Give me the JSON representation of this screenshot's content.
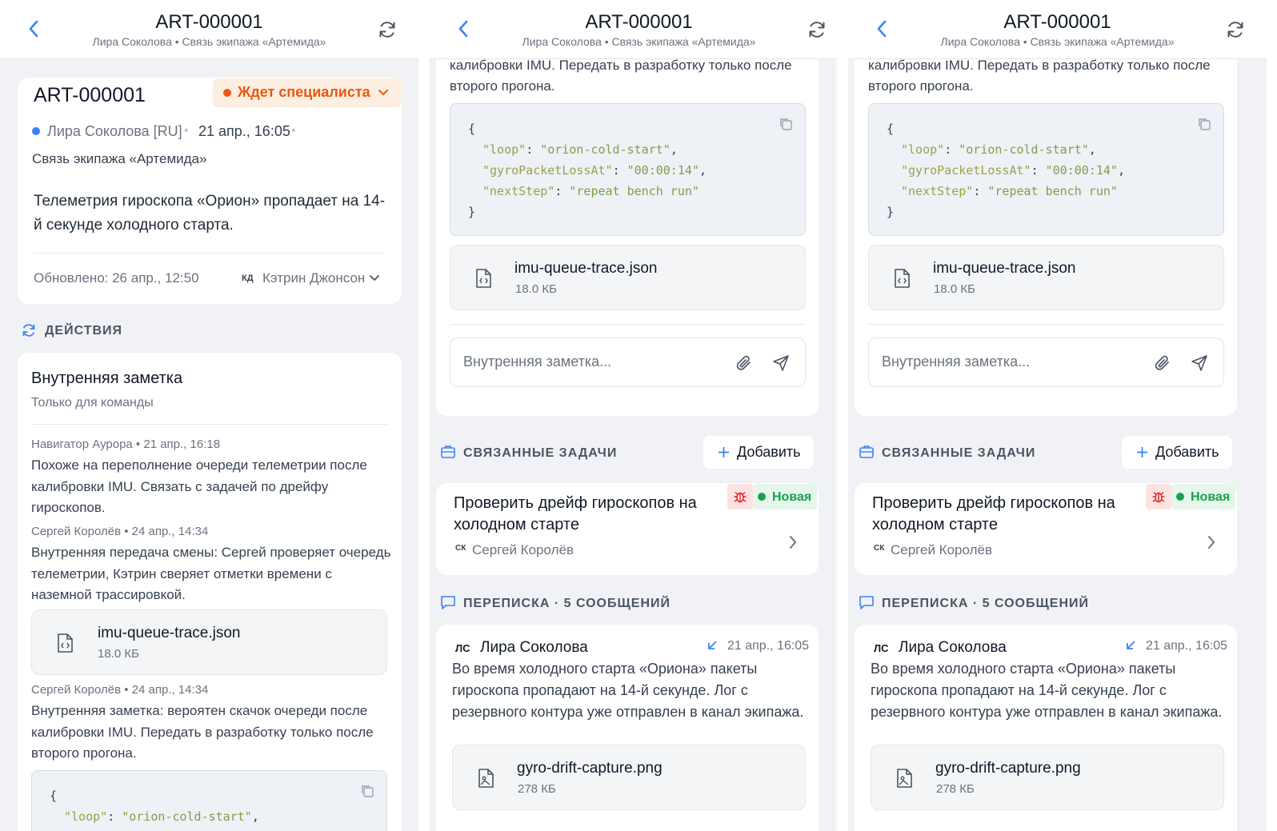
{
  "header": {
    "title": "ART-000001",
    "subtitle": "Лира Соколова • Связь экипажа «Артемида»"
  },
  "ticket": {
    "id": "ART-000001",
    "status": "Ждет специалиста",
    "requester": "Лира Соколова [RU]",
    "created": "21 апр., 16:05",
    "channel": "Связь экипажа «Артемида»",
    "description": "Телеметрия гироскопа «Орион» пропадает на 14-й секунде холодного старта.",
    "updated": "Обновлено: 26 апр., 12:50",
    "assignee_initials": "КД",
    "assignee": "Кэтрин Джонсон"
  },
  "actions": {
    "title": "ДЕЙСТВИЯ",
    "note_card_title": "Внутренняя заметка",
    "note_card_subtitle": "Только для команды"
  },
  "notes": [
    {
      "meta": "Навигатор Аурора • 21 апр., 16:18",
      "text": "Похоже на переполнение очереди телеметрии после калибровки IMU. Связать с задачей по дрейфу гироскопов."
    },
    {
      "meta": "Сергей Королёв • 24 апр., 14:34",
      "text": "Внутренняя передача смены: Сергей проверяет очередь телеметрии, Кэтрин сверяет отметки времени с наземной трассировкой."
    },
    {
      "meta": "Сергей Королёв • 24 апр., 14:34",
      "text": "Внутренняя заметка: вероятен скачок очереди после калибровки IMU. Передать в разработку только после второго прогона."
    }
  ],
  "note_tail": {
    "line1": "калибровки IMU. Передать в разработку только после",
    "line2": "второго прогона."
  },
  "code": {
    "open": "{",
    "close": "}",
    "k1": "\"loop\"",
    "v1": "\"orion-cold-start\"",
    "k2": "\"gyroPacketLossAt\"",
    "v2": "\"00:00:14\"",
    "k3": "\"nextStep\"",
    "v3": "\"repeat bench run\""
  },
  "file": {
    "name": "imu-queue-trace.json",
    "size": "18.0 КБ"
  },
  "composer": {
    "placeholder": "Внутренняя заметка..."
  },
  "related": {
    "title": "СВЯЗАННЫЕ ЗАДАЧИ",
    "add_label": "Добавить",
    "task_title": "Проверить дрейф гироскопов на холодном старте",
    "task_status": "Новая",
    "task_assignee_initials": "СК",
    "task_assignee": "Сергей Королёв"
  },
  "conversation": {
    "title": "ПЕРЕПИСКА · 5 СООБЩЕНИЙ",
    "msg_initials": "ЛС",
    "msg_author": "Лира Соколова",
    "msg_time": "21 апр., 16:05",
    "msg_text": "Во время холодного старта «Ориона» пакеты гироскопа пропадают на 14-й секунде. Лог с резервного контура уже отправлен в канал экипажа.",
    "attachment_name": "gyro-drift-capture.png",
    "attachment_size": "278 КБ"
  },
  "colors": {
    "accent": "#3b82f6",
    "status_orange": "#ea580c",
    "new_green": "#16a34a",
    "bug_red": "#dc2626"
  },
  "icons": [
    "chevron-left-icon",
    "refresh-icon",
    "copy-icon",
    "file-code-icon",
    "paperclip-icon",
    "send-icon",
    "briefcase-icon",
    "plus-icon",
    "bug-icon",
    "chevron-right-icon",
    "chat-icon",
    "incoming-arrow-icon",
    "file-image-icon"
  ]
}
